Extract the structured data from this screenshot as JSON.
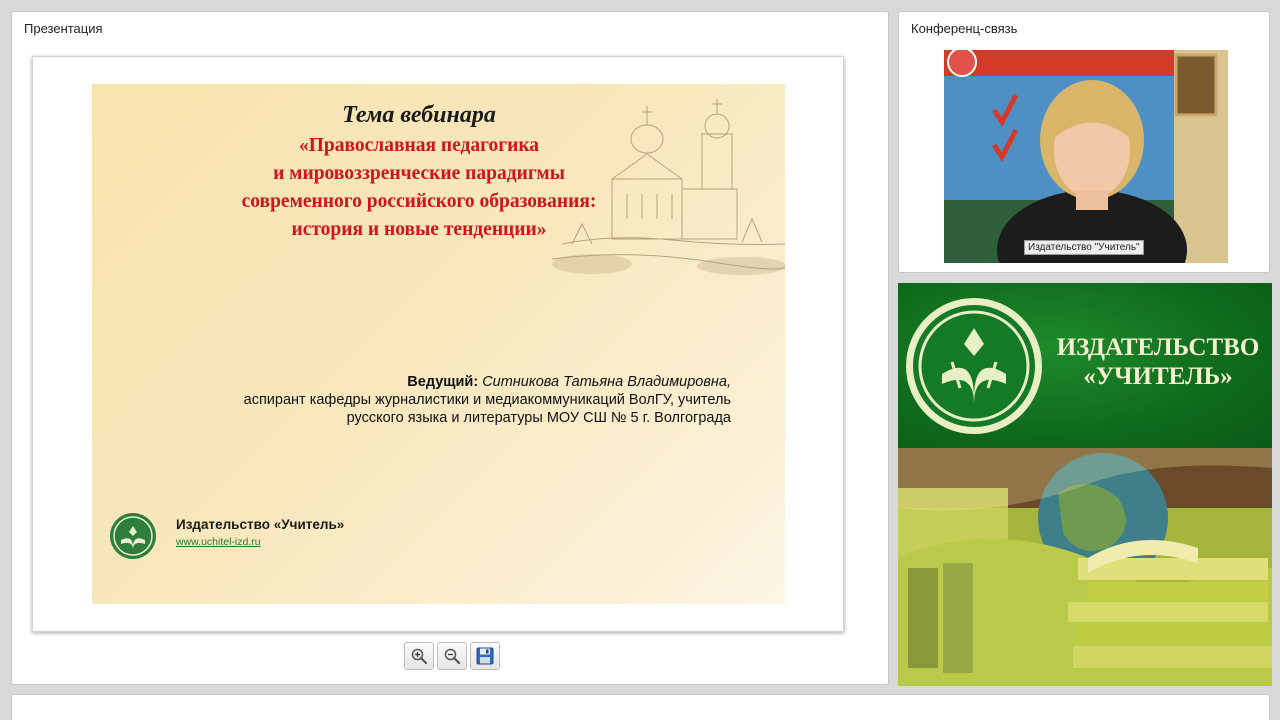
{
  "presentation_panel": {
    "title": "Презентация",
    "slide": {
      "heading": "Тема вебинара",
      "topic": "«Православная педагогика\nи мировоззренческие парадигмы\nсовременного российского образования:\nистория и новые тенденции»",
      "presenter_label": "Ведущий:",
      "presenter_name": "Ситникова Татьяна Владимировна,",
      "presenter_line2": "аспирант кафедры журналистики и медиакоммуникаций ВолГУ, учитель",
      "presenter_line3": "русского языка и литературы МОУ СШ № 5 г. Волгограда",
      "publisher_name": "Издательство «Учитель»",
      "publisher_url": "www.uchitel-izd.ru"
    },
    "toolbar": {
      "zoom_in_icon": "zoom-in-icon",
      "zoom_out_icon": "zoom-out-icon",
      "save_icon": "floppy-disk-icon"
    }
  },
  "conference_panel": {
    "title": "Конференц-связь",
    "video_label": "Издательство \"Учитель\""
  },
  "banner": {
    "title": "ИЗДАТЕЛЬСТВО\n«УЧИТЕЛЬ»"
  },
  "colors": {
    "slide_topic_red": "#d4121a",
    "banner_green": "#0f6a1c",
    "slide_background": "#f8e6b8"
  }
}
